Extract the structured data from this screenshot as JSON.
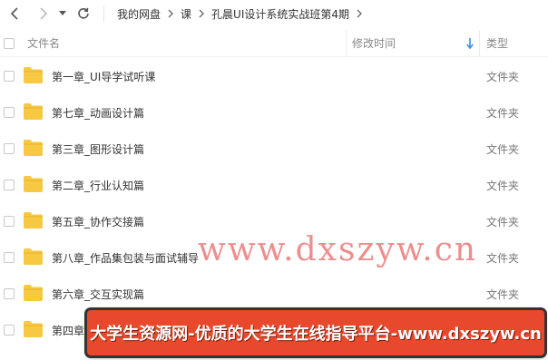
{
  "toolbar": {
    "back_icon": "chevron-left-icon",
    "forward_icon": "chevron-right-icon",
    "dropdown_icon": "caret-down-icon",
    "refresh_icon": "refresh-icon",
    "breadcrumb": [
      "我的网盘",
      "课",
      "孔晨UI设计系统实战班第4期"
    ]
  },
  "header": {
    "name_label": "文件名",
    "time_label": "修改时间",
    "type_label": "类型",
    "sort_icon": "arrow-down-icon",
    "accent": "#3b8df0"
  },
  "files": [
    {
      "name": "第一章_UI导学试听课",
      "type": "文件夹"
    },
    {
      "name": "第七章_动画设计篇",
      "type": "文件夹"
    },
    {
      "name": "第三章_图形设计篇",
      "type": "文件夹"
    },
    {
      "name": "第二章_行业认知篇",
      "type": "文件夹"
    },
    {
      "name": "第五章_协作交接篇",
      "type": "文件夹"
    },
    {
      "name": "第八章_作品集包装与面试辅导",
      "type": "文件夹"
    },
    {
      "name": "第六章_交互实现篇",
      "type": "文件夹"
    },
    {
      "name": "第四章",
      "type": "文件夹"
    }
  ],
  "folder_color": "#f7c842",
  "overlay": {
    "watermark": "www.dxszyw.cn",
    "banner": "大学生资源网-优质的大学生在线指导平台-www.dxszyw.cn",
    "banner_color": "#e8492c"
  }
}
